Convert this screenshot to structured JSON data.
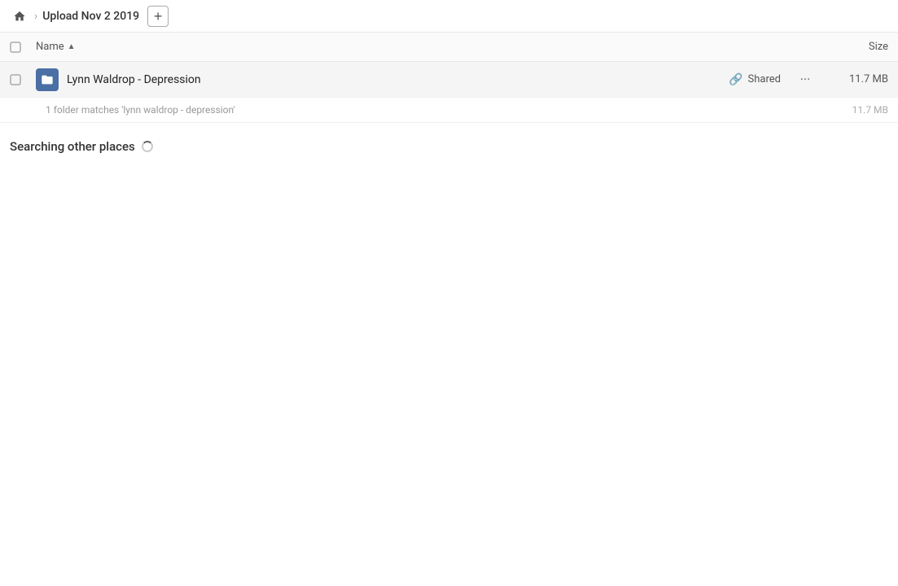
{
  "topbar": {
    "home_title": "Home",
    "breadcrumb_text": "Upload Nov 2 2019",
    "add_button_label": "+"
  },
  "columns": {
    "name_label": "Name",
    "size_label": "Size",
    "sort_indicator": "▲"
  },
  "file_row": {
    "name": "Lynn Waldrop - Depression",
    "shared_label": "Shared",
    "more_label": "···",
    "size": "11.7 MB"
  },
  "match_row": {
    "match_text": "1 folder matches 'lynn waldrop - depression'",
    "size": "11.7 MB"
  },
  "searching": {
    "title": "Searching other places"
  }
}
